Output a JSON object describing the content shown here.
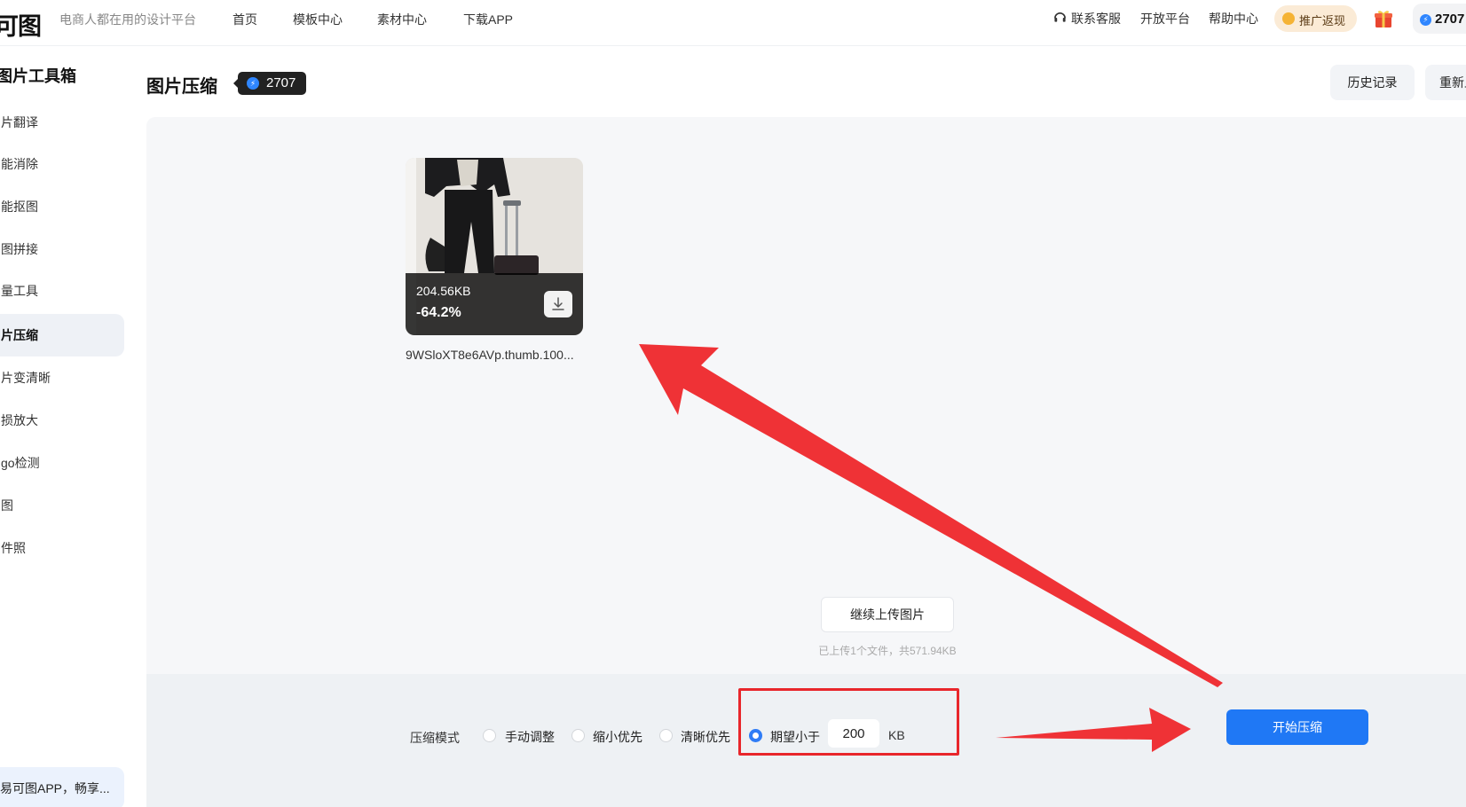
{
  "header": {
    "logo": "可图",
    "tagline": "电商人都在用的设计平台",
    "nav": [
      "首页",
      "模板中心",
      "素材中心",
      "下载APP"
    ],
    "support": "联系客服",
    "open_platform": "开放平台",
    "help": "帮助中心",
    "promo": "推广返现",
    "coins": "2707"
  },
  "sidebar": {
    "title": "图片工具箱",
    "items": [
      "片翻译",
      "能消除",
      "能抠图",
      "图拼接",
      "量工具",
      "片压缩",
      "片变清晰",
      "损放大",
      "go检测",
      "图",
      "件照"
    ],
    "active_index": 5,
    "banner": "易可图APP，畅享..."
  },
  "page": {
    "title": "图片压缩",
    "badge_count": "2707",
    "history_button": "历史记录",
    "reset_button": "重新上传"
  },
  "thumbnail": {
    "size": "204.56KB",
    "ratio": "-64.2%",
    "filename": "9WSloXT8e6AVp.thumb.100..."
  },
  "upload": {
    "more_button": "继续上传图片",
    "status": "已上传1个文件，共571.94KB"
  },
  "toolbar": {
    "mode_label": "压缩模式",
    "options": [
      "手动调整",
      "缩小优先",
      "清晰优先",
      "期望小于"
    ],
    "selected_index": 3,
    "target_value": "200",
    "unit": "KB",
    "start_button": "开始压缩"
  },
  "colors": {
    "accent": "#1f78f5",
    "annotation": "#ef3236"
  }
}
